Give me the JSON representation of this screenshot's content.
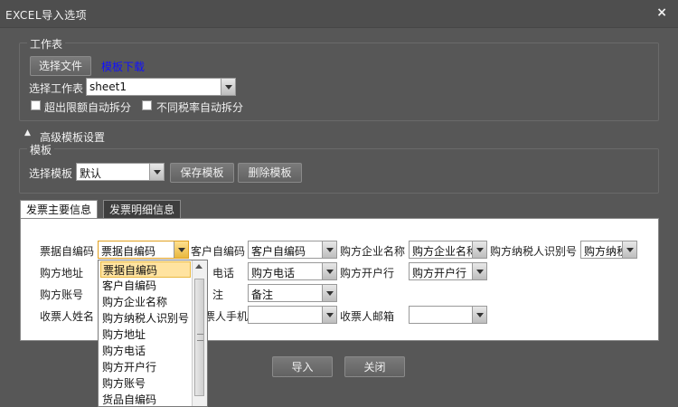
{
  "window": {
    "title": "EXCEL导入选项",
    "close": "×"
  },
  "worksheet": {
    "legend": "工作表",
    "choose_file": "选择文件",
    "template_download": "模板下载",
    "select_sheet_label": "选择工作表",
    "sheet_value": "sheet1",
    "auto_split_limit": "超出限额自动拆分",
    "auto_split_tax": "不同税率自动拆分"
  },
  "advanced": {
    "toggle_icon": "caret-up-icon",
    "title": "高级模板设置",
    "template_legend": "模板",
    "select_template_label": "选择模板",
    "template_value": "默认",
    "save_template": "保存模板",
    "delete_template": "删除模板"
  },
  "tabs": [
    {
      "label": "发票主要信息",
      "active": true
    },
    {
      "label": "发票明细信息",
      "active": false
    }
  ],
  "fields": {
    "bill_code": {
      "label": "票据自编码",
      "value": "票据自编码"
    },
    "customer_code": {
      "label": "客户自编码",
      "value": "客户自编码"
    },
    "buyer_name": {
      "label": "购方企业名称",
      "value": "购方企业名称"
    },
    "buyer_taxid": {
      "label": "购方纳税人识别号",
      "value": "购方纳税"
    },
    "buyer_addr": {
      "label": "购方地址"
    },
    "buyer_phone": {
      "label": "电话",
      "value": "购方电话"
    },
    "buyer_bank": {
      "label": "购方开户行",
      "value": "购方开户行"
    },
    "buyer_account": {
      "label": "购方账号"
    },
    "remark": {
      "label": "注",
      "value": "备注"
    },
    "receiver_name": {
      "label": "收票人姓名"
    },
    "receiver_phone": {
      "label": "票人手机",
      "value": ""
    },
    "receiver_email": {
      "label": "收票人邮箱",
      "value": ""
    }
  },
  "dropdown": {
    "items": [
      "票据自编码",
      "客户自编码",
      "购方企业名称",
      "购方纳税人识别号",
      "购方地址",
      "购方电话",
      "购方开户行",
      "购方账号",
      "货品自编码"
    ],
    "selected_index": 0
  },
  "footer": {
    "import": "导入",
    "close": "关闭"
  }
}
